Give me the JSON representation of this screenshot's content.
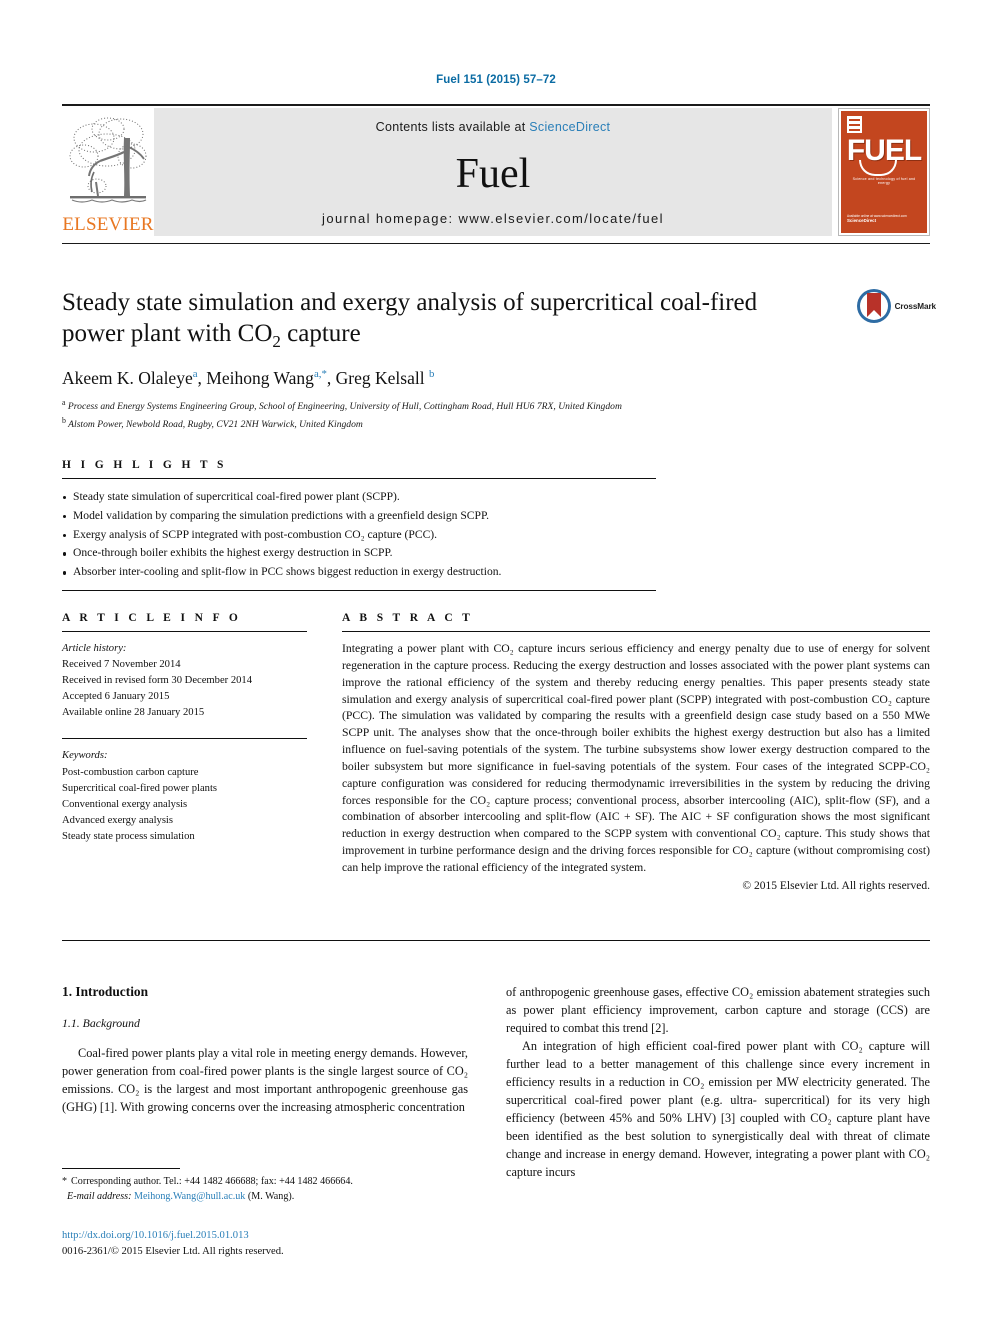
{
  "running_head": "Fuel 151 (2015) 57–72",
  "masthead": {
    "publisher": "ELSEVIER",
    "contents_prefix": "Contents lists available at ",
    "sciencedirect": "ScienceDirect",
    "journal_name": "Fuel",
    "homepage": "journal homepage: www.elsevier.com/locate/fuel",
    "cover": {
      "wordmark": "FUEL",
      "subtitle": "Science and technology of fuel and energy",
      "footer_line1": "Available online at www.sciencedirect.com",
      "footer_line2": "ScienceDirect"
    }
  },
  "article": {
    "title_line1": "Steady state simulation and exergy analysis of supercritical coal-fired",
    "title_line2_pre": "power plant with CO",
    "title_sub": "2",
    "title_line2_post": " capture",
    "authors": [
      {
        "name": "Akeem K. Olaleye",
        "marks": "a"
      },
      {
        "name": "Meihong Wang",
        "marks": "a,*"
      },
      {
        "name": "Greg Kelsall",
        "marks": "b"
      }
    ],
    "affiliations": [
      {
        "mark": "a",
        "text": "Process and Energy Systems Engineering Group, School of Engineering, University of Hull, Cottingham Road, Hull HU6 7RX, United Kingdom"
      },
      {
        "mark": "b",
        "text": "Alstom Power, Newbold Road, Rugby, CV21 2NH Warwick, United Kingdom"
      }
    ],
    "crossmark_label": "CrossMark"
  },
  "highlights": {
    "heading": "H I G H L I G H T S",
    "items": [
      "Steady state simulation of supercritical coal-fired power plant (SCPP).",
      "Model validation by comparing the simulation predictions with a greenfield design SCPP.",
      "Exergy analysis of SCPP integrated with post-combustion CO₂ capture (PCC).",
      "Once-through boiler exhibits the highest exergy destruction in SCPP.",
      "Absorber inter-cooling and split-flow in PCC shows biggest reduction in exergy destruction."
    ]
  },
  "article_info": {
    "heading": "A R T I C L E    I N F O",
    "history_label": "Article history:",
    "history": [
      "Received 7 November 2014",
      "Received in revised form 30 December 2014",
      "Accepted 6 January 2015",
      "Available online 28 January 2015"
    ],
    "keywords_label": "Keywords:",
    "keywords": [
      "Post-combustion carbon capture",
      "Supercritical coal-fired power plants",
      "Conventional exergy analysis",
      "Advanced exergy analysis",
      "Steady state process simulation"
    ]
  },
  "abstract": {
    "heading": "A B S T R A C T",
    "text": "Integrating a power plant with CO₂ capture incurs serious efficiency and energy penalty due to use of energy for solvent regeneration in the capture process. Reducing the exergy destruction and losses associated with the power plant systems can improve the rational efficiency of the system and thereby reducing energy penalties. This paper presents steady state simulation and exergy analysis of supercritical coal-fired power plant (SCPP) integrated with post-combustion CO₂ capture (PCC). The simulation was validated by comparing the results with a greenfield design case study based on a 550 MWe SCPP unit. The analyses show that the once-through boiler exhibits the highest exergy destruction but also has a limited influence on fuel-saving potentials of the system. The turbine subsystems show lower exergy destruction compared to the boiler subsystem but more significance in fuel-saving potentials of the system. Four cases of the integrated SCPP-CO₂ capture configuration was considered for reducing thermodynamic irreversibilities in the system by reducing the driving forces responsible for the CO₂ capture process; conventional process, absorber intercooling (AIC), split-flow (SF), and a combination of absorber intercooling and split-flow (AIC + SF). The AIC + SF configuration shows the most significant reduction in exergy destruction when compared to the SCPP system with conventional CO₂ capture. This study shows that improvement in turbine performance design and the driving forces responsible for CO₂ capture (without compromising cost) can help improve the rational efficiency of the integrated system.",
    "copyright": "© 2015 Elsevier Ltd. All rights reserved."
  },
  "body": {
    "section_title": "1. Introduction",
    "subsection_title": "1.1. Background",
    "left_paragraph": "Coal-fired power plants play a vital role in meeting energy demands. However, power generation from coal-fired power plants is the single largest source of CO₂ emissions. CO₂ is the largest and most important anthropogenic greenhouse gas (GHG) [1]. With growing concerns over the increasing atmospheric concentration",
    "right_paragraph_1": "of anthropogenic greenhouse gases, effective CO₂ emission abatement strategies such as power plant efficiency improvement, carbon capture and storage (CCS) are required to combat this trend [2].",
    "right_paragraph_2": "An integration of high efficient coal-fired power plant with CO₂ capture will further lead to a better management of this challenge since every increment in efficiency results in a reduction in CO₂ emission per MW electricity generated. The supercritical coal-fired power plant (e.g. ultra- supercritical) for its very high efficiency (between 45% and 50% LHV) [3] coupled with CO₂ capture plant have been identified as the best solution to synergistically deal with threat of climate change and increase in energy demand. However, integrating a power plant with CO₂ capture incurs",
    "ref_1": "[1]",
    "ref_2": "[2]",
    "ref_3": "[3]"
  },
  "footnote": {
    "star": "*",
    "corresponding": "Corresponding author. Tel.: +44 1482 466688; fax: +44 1482 466664.",
    "email_label": "E-mail address:",
    "email": "Meihong.Wang@hull.ac.uk",
    "email_owner": "(M. Wang)."
  },
  "footer": {
    "doi": "http://dx.doi.org/10.1016/j.fuel.2015.01.013",
    "issn": "0016-2361/© 2015 Elsevier Ltd. All rights reserved."
  },
  "colors": {
    "link_blue": "#2a7fb8",
    "header_blue": "#0a6ba3",
    "elsevier_orange": "#e87722",
    "cover_orange": "#c3461f",
    "masthead_gray": "#e6e6e6"
  }
}
